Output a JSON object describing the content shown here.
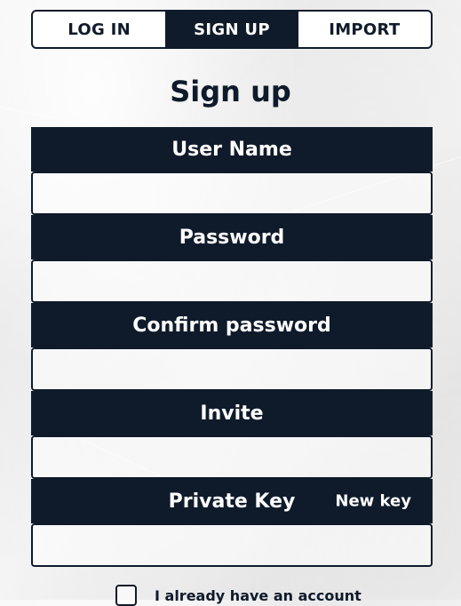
{
  "tabs": [
    {
      "label": "LOG IN",
      "active": false
    },
    {
      "label": "SIGN UP",
      "active": true
    },
    {
      "label": "IMPORT",
      "active": false
    }
  ],
  "title": "Sign up",
  "fields": {
    "username": {
      "label": "User Name",
      "value": "",
      "placeholder": ""
    },
    "password": {
      "label": "Password",
      "value": "",
      "placeholder": ""
    },
    "confirm_password": {
      "label": "Confirm password",
      "value": "",
      "placeholder": ""
    },
    "invite": {
      "label": "Invite",
      "value": "",
      "placeholder": ""
    },
    "private_key": {
      "label": "Private Key",
      "value": "",
      "placeholder": "",
      "new_key_label": "New key"
    }
  },
  "already_have_account": {
    "label": "I already have an account",
    "checked": false
  },
  "colors": {
    "primary": "#0f1b2b",
    "on_primary": "#ffffff",
    "background": "#f0f0f0"
  }
}
